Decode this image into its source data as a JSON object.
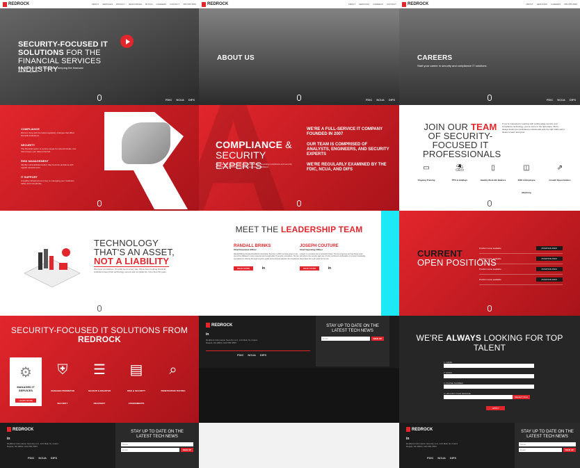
{
  "brand": {
    "name": "REDROCK",
    "accent": "#e2262c"
  },
  "nav": [
    "ABOUT",
    "SERVICES",
    "PRIVACY",
    "RESOURCES",
    "BLOGS",
    "CAREERS",
    "CONTACT",
    "GET IN TOUCH",
    "555-555-5555"
  ],
  "hero": {
    "title_bold": "SECURITY-FOCUSED IT SOLUTIONS",
    "title_light": "FOR THE FINANCIAL SERVICES INDUSTRY",
    "subtitle": "More than 20 years' experience keeping the financial world compliant"
  },
  "about": {
    "title": "ABOUT US"
  },
  "careers": {
    "title": "CAREERS",
    "subtitle": "Start your career in security and compliance IT solutions"
  },
  "partners": [
    "FDIC",
    "NCUA",
    "DIFS"
  ],
  "services": [
    {
      "title": "COMPLIANCE",
      "text": "We're in tune with the latest regulatory changes that affect financial institutions."
    },
    {
      "title": "SECURITY",
      "text": "The financial sector is a prime target for cybercriminals. Our team keeps your data protected."
    },
    {
      "title": "RISK MANAGEMENT",
      "text": "Identify vulnerabilities before they become problems with regular assessments."
    },
    {
      "title": "IT SUPPORT",
      "text": "A healthy infrastructure is key to managing your institution safely and compliantly."
    }
  ],
  "compliance": {
    "title_bold": "COMPLIANCE",
    "amp": "&",
    "title_light": "SECURITY EXPERTS",
    "text": "Our team has more than 20 years of experience providing compliance and security IT solutions to financial organizations across the Midwest.",
    "facts": [
      "WE'RE A FULL-SERVICE IT COMPANY FOUNDED IN 2007",
      "OUR TEAM IS COMPRISED OF ANALYSTS, ENGINEERS, AND SECURITY EXPERTS",
      "WE'RE REGULARLY EXAMINED BY THE FDIC, NCUA, AND DIFS"
    ]
  },
  "join": {
    "title_a": "JOIN OUR",
    "title_b": "TEAM",
    "title_c": "OF SECURITY-FOCUSED IT PROFESSIONALS",
    "text": "If you're interested in working with cutting-edge security and compliance technology, you've come to the right place. We're always looking for dedicated professionals with the right skills and a desire to learn and grow.",
    "benefits": [
      {
        "label": "Ongoing Training",
        "icon": "monitor-icon",
        "glyph": "▭"
      },
      {
        "label": "PTO & Holidays",
        "icon": "beach-icon",
        "glyph": "⛱"
      },
      {
        "label": "Healthy Work-life Balance",
        "icon": "phone-icon",
        "glyph": "▯"
      },
      {
        "label": "401K & Employee Matching",
        "icon": "piggy-icon",
        "glyph": "◫"
      },
      {
        "label": "Growth Opportunities",
        "icon": "growth-icon",
        "glyph": "⇗"
      }
    ]
  },
  "tech": {
    "title_a": "TECHNOLOGY THAT'S AN ASSET,",
    "title_b": "NOT A LIABILITY",
    "text": "We know compliance. It's what we do every day. We've been helping financial institutions keep their technology secure and compliant for more than 20 years."
  },
  "leadership": {
    "title_a": "MEET THE",
    "title_b": "LEADERSHIP TEAM",
    "people": [
      {
        "name": "RANDALL BRINKS",
        "role": "Chief Executive Officer",
        "bio": "Randall Brinks founded RedRock Information Security in 2007 and has grown it into one of the Midwest's most respected and sought-after IT security companies. He has specialized in offering thorough security audits and technical solutions for compliance."
      },
      {
        "name": "JOSEPH COUTURE",
        "role": "Chief Operating Officer",
        "bio": "Joseph is a creative and a technical thinker. He loves figuring out how things work, and where the security gaps are. It's the combined combination of a better knowledge that makes him well suited for his role."
      }
    ],
    "read_more": "READ MORE"
  },
  "positions": {
    "title_a": "CURRENT",
    "title_b": "OPEN POSITIONS",
    "rows": [
      "Position name available",
      "Position name available",
      "Position name available",
      "Position name available"
    ],
    "btn": "POSITION INFO"
  },
  "solutions": {
    "title_a": "SECURITY-FOCUSED IT SOLUTIONS FROM",
    "title_b": "REDROCK",
    "items": [
      {
        "label": "MANAGED IT SERVICES",
        "icon": "gears-icon",
        "glyph": "⚙",
        "active": true
      },
      {
        "label": "MANAGED PERIMETER SECURITY",
        "icon": "shield-icon",
        "glyph": "⛨"
      },
      {
        "label": "BACKUP & DISASTER RECOVERY",
        "icon": "database-icon",
        "glyph": "☰"
      },
      {
        "label": "RISK & SECURITY ASSESSMENTS",
        "icon": "clipboard-icon",
        "glyph": "▤"
      },
      {
        "label": "PENETRATION TESTING",
        "icon": "magnifier-icon",
        "glyph": "⌕"
      }
    ],
    "learn_more": "LEARN MORE"
  },
  "footer": {
    "linkedin": "in",
    "address": "RedRock Information Security LLC, 123 Main St, Grand Rapids, MI 49503, 616-555-5555",
    "newsletter_a": "STAY UP TO DATE ON THE",
    "newsletter_b": "LATEST TECH NEWS",
    "name_ph": "Name",
    "email_ph": "Email",
    "signup": "SIGN UP"
  },
  "talent": {
    "title_a": "WE'RE",
    "title_b": "ALWAYS",
    "title_c": "LOOKING FOR TOP TALENT",
    "fields": [
      "1. NAME",
      "2. EMAIL",
      "3. PHONE NUMBER",
      "4. UPLOAD YOUR RESUME"
    ],
    "select": "SELECT FILE",
    "submit": "APPLY"
  }
}
